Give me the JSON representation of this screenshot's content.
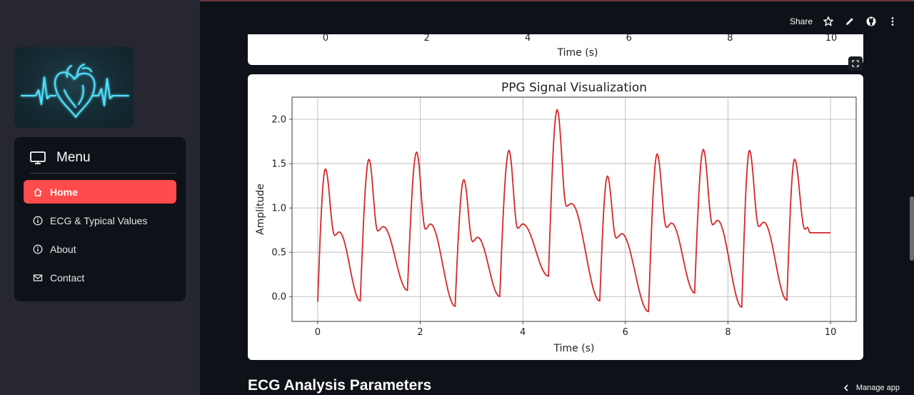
{
  "header": {
    "share_label": "Share",
    "icons": [
      "star-icon",
      "edit-icon",
      "github-icon",
      "more-icon"
    ]
  },
  "sidebar": {
    "menu_title": "Menu",
    "items": [
      {
        "label": "Home",
        "icon": "home-icon",
        "active": true
      },
      {
        "label": "ECG & Typical Values",
        "icon": "info-icon",
        "active": false
      },
      {
        "label": "About",
        "icon": "info-icon",
        "active": false
      },
      {
        "label": "Contact",
        "icon": "mail-icon",
        "active": false
      }
    ],
    "accent_color": "#ff4b4b"
  },
  "top_chart": {
    "xlabel": "Time (s)",
    "xticks": [
      0,
      2,
      4,
      6,
      8,
      10
    ]
  },
  "main": {
    "section_heading": "ECG Analysis Parameters",
    "manage_app_label": "Manage app"
  },
  "chart_data": {
    "type": "line",
    "title": "PPG Signal Visualization",
    "xlabel": "Time (s)",
    "ylabel": "Amplitude",
    "xlim": [
      -0.5,
      10.5
    ],
    "ylim": [
      -0.28,
      2.25
    ],
    "xticks": [
      0,
      2,
      4,
      6,
      8,
      10
    ],
    "yticks": [
      0.0,
      0.5,
      1.0,
      1.5,
      2.0
    ],
    "grid": true,
    "line_color": "#d62728",
    "series": [
      {
        "name": "",
        "beats": [
          {
            "onset": 0.0,
            "onset_value": -0.06,
            "peak_t": 0.15,
            "peak": 1.44,
            "notch_t": 0.33,
            "notch": 0.69,
            "dicro_t": 0.42,
            "dicro": 0.73,
            "valley_t": 0.83,
            "valley": -0.05
          },
          {
            "onset": 0.83,
            "onset_value": -0.05,
            "peak_t": 1.0,
            "peak": 1.55,
            "notch_t": 1.17,
            "notch": 0.74,
            "dicro_t": 1.28,
            "dicro": 0.79,
            "valley_t": 1.75,
            "valley": 0.07
          },
          {
            "onset": 1.75,
            "onset_value": 0.07,
            "peak_t": 1.93,
            "peak": 1.63,
            "notch_t": 2.1,
            "notch": 0.76,
            "dicro_t": 2.2,
            "dicro": 0.82,
            "valley_t": 2.68,
            "valley": -0.11
          },
          {
            "onset": 2.68,
            "onset_value": -0.11,
            "peak_t": 2.85,
            "peak": 1.32,
            "notch_t": 3.02,
            "notch": 0.62,
            "dicro_t": 3.12,
            "dicro": 0.67,
            "valley_t": 3.55,
            "valley": 0.0
          },
          {
            "onset": 3.55,
            "onset_value": 0.0,
            "peak_t": 3.73,
            "peak": 1.65,
            "notch_t": 3.9,
            "notch": 0.77,
            "dicro_t": 4.0,
            "dicro": 0.82,
            "valley_t": 4.5,
            "valley": 0.23
          },
          {
            "onset": 4.5,
            "onset_value": 0.23,
            "peak_t": 4.67,
            "peak": 2.11,
            "notch_t": 4.85,
            "notch": 1.02,
            "dicro_t": 4.95,
            "dicro": 1.05,
            "valley_t": 5.5,
            "valley": -0.05
          },
          {
            "onset": 5.5,
            "onset_value": -0.05,
            "peak_t": 5.65,
            "peak": 1.36,
            "notch_t": 5.82,
            "notch": 0.66,
            "dicro_t": 5.93,
            "dicro": 0.71,
            "valley_t": 6.45,
            "valley": -0.17
          },
          {
            "onset": 6.45,
            "onset_value": -0.17,
            "peak_t": 6.62,
            "peak": 1.61,
            "notch_t": 6.8,
            "notch": 0.78,
            "dicro_t": 6.9,
            "dicro": 0.83,
            "valley_t": 7.35,
            "valley": 0.04
          },
          {
            "onset": 7.35,
            "onset_value": 0.04,
            "peak_t": 7.52,
            "peak": 1.66,
            "notch_t": 7.7,
            "notch": 0.81,
            "dicro_t": 7.8,
            "dicro": 0.86,
            "valley_t": 8.27,
            "valley": -0.12
          },
          {
            "onset": 8.27,
            "onset_value": -0.12,
            "peak_t": 8.42,
            "peak": 1.65,
            "notch_t": 8.6,
            "notch": 0.79,
            "dicro_t": 8.7,
            "dicro": 0.84,
            "valley_t": 9.15,
            "valley": -0.04
          },
          {
            "onset": 9.15,
            "onset_value": -0.04,
            "peak_t": 9.3,
            "peak": 1.55,
            "notch_t": 9.5,
            "notch": 0.76,
            "dicro_t": 9.55,
            "dicro": 0.78,
            "valley_t": 9.6,
            "valley": 0.72
          }
        ],
        "tail": [
          [
            9.6,
            0.72
          ],
          [
            10.0,
            0.72
          ]
        ]
      }
    ]
  }
}
